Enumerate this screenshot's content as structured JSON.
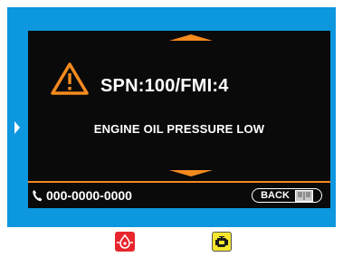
{
  "screen": {
    "fault_code": "SPN:100/FMI:4",
    "description": "ENGINE OIL PRESSURE LOW",
    "phone_number": "000-0000-0000",
    "back_label": "BACK"
  },
  "icons": {
    "warning": "warning-triangle-icon",
    "phone": "phone-icon",
    "back": "book-icon",
    "indicator_left": "oil-pressure-icon",
    "indicator_right": "check-engine-icon"
  },
  "colors": {
    "bezel": "#0d97de",
    "screen_bg": "#0a0a0a",
    "accent": "#f58a1f",
    "indicator_red": "#e8262d",
    "indicator_yellow": "#f5e62d"
  }
}
